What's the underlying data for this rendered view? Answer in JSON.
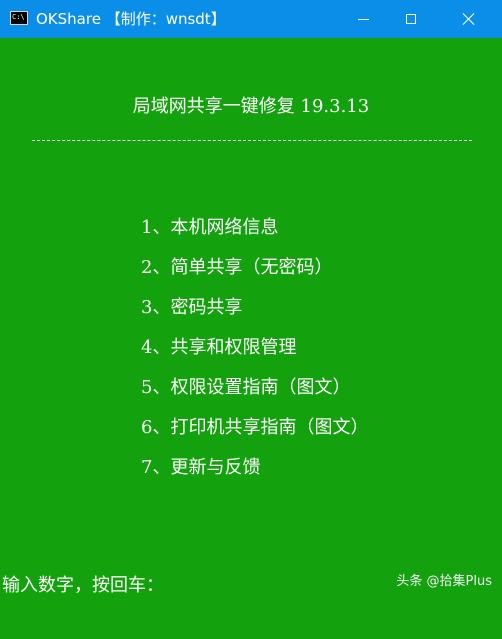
{
  "window": {
    "title": "OKShare 【制作：wnsdt】",
    "icon_name": "console-icon",
    "icon_glyph": "C:\\",
    "controls": [
      "minimize-icon",
      "maximize-icon",
      "close-icon"
    ],
    "title_bar_color": "#0a8ee8",
    "background_color": "#13a10e"
  },
  "console": {
    "heading": "局域网共享一键修复 19.3.13",
    "divider": "------------------------------------------------------------",
    "menu": [
      "1、本机网络信息",
      "2、简单共享（无密码）",
      "3、密码共享",
      "4、共享和权限管理",
      "5、权限设置指南（图文）",
      "6、打印机共享指南（图文）",
      "7、更新与反馈"
    ],
    "prompt": "输入数字，按回车：",
    "text_color": "#ffffff"
  },
  "watermark": {
    "text": "头条 @拾集Plus"
  }
}
